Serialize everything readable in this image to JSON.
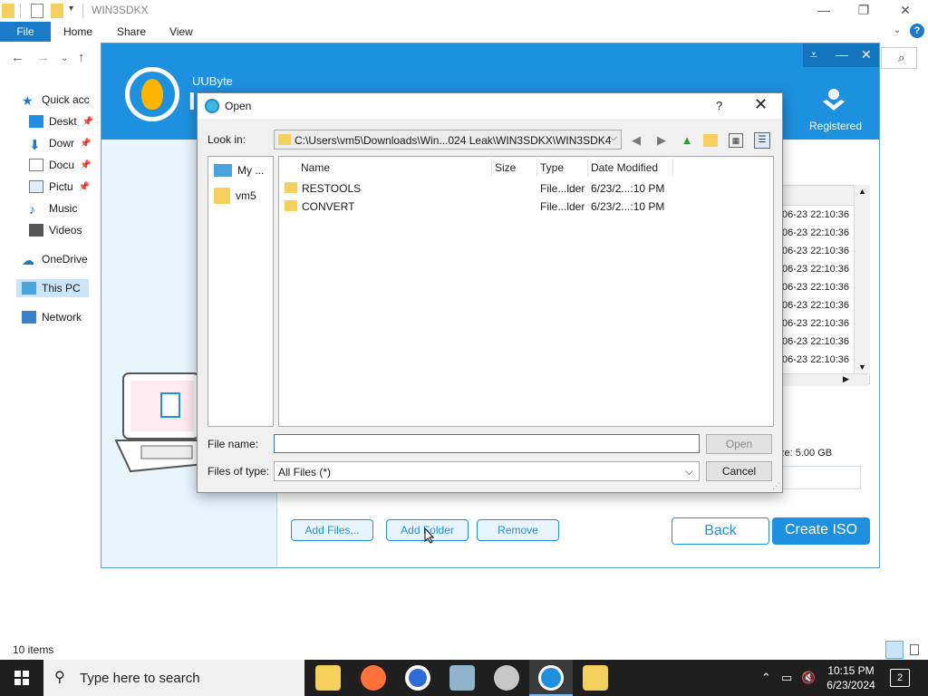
{
  "explorer": {
    "title": "WIN3SDKX",
    "ribbon": {
      "file": "File",
      "home": "Home",
      "share": "Share",
      "view": "View"
    },
    "sidebar": {
      "quick_access": "Quick acc",
      "desktop": "Deskt",
      "downloads": "Dowr",
      "documents": "Docu",
      "pictures": "Pictu",
      "music": "Music",
      "videos": "Videos",
      "onedrive": "OneDrive",
      "this_pc": "This PC",
      "network": "Network"
    },
    "status": "10 items"
  },
  "app": {
    "brand": "UUByte",
    "name_fragment": "I",
    "registered": "Registered",
    "list_timestamps": [
      "06-23 22:10:36",
      "06-23 22:10:36",
      "06-23 22:10:36",
      "06-23 22:10:36",
      "06-23 22:10:36",
      "06-23 22:10:36",
      "06-23 22:10:36",
      "06-23 22:10:36",
      "06-23 22:10:36"
    ],
    "size_label": "ze: 5.00 GB",
    "buttons": {
      "add_files": "Add Files...",
      "add_folder": "Add Folder",
      "remove": "Remove",
      "back": "Back",
      "create_iso": "Create ISO"
    },
    "accent": "#1e90e0"
  },
  "dialog": {
    "title": "Open",
    "help": "?",
    "look_in_label": "Look in:",
    "look_in_path": "C:\\Users\\vm5\\Downloads\\Win...024 Leak\\WIN3SDKX\\WIN3SDK4",
    "places": [
      {
        "label": "My ...",
        "icon": "computer-icon"
      },
      {
        "label": "vm5",
        "icon": "user-folder-icon"
      }
    ],
    "columns": {
      "name": "Name",
      "size": "Size",
      "type": "Type",
      "date": "Date Modified"
    },
    "files": [
      {
        "name": "RESTOOLS",
        "size": "",
        "type": "File...lder",
        "date": "6/23/2...:10 PM"
      },
      {
        "name": "CONVERT",
        "size": "",
        "type": "File...lder",
        "date": "6/23/2...:10 PM"
      }
    ],
    "file_name_label": "File name:",
    "file_name_value": "",
    "files_of_type_label": "Files of type:",
    "files_of_type_value": "All Files (*)",
    "open_button": "Open",
    "cancel_button": "Cancel"
  },
  "taskbar": {
    "search_placeholder": "Type here to search",
    "time": "10:15 PM",
    "date": "6/23/2024",
    "notifications": "2"
  }
}
